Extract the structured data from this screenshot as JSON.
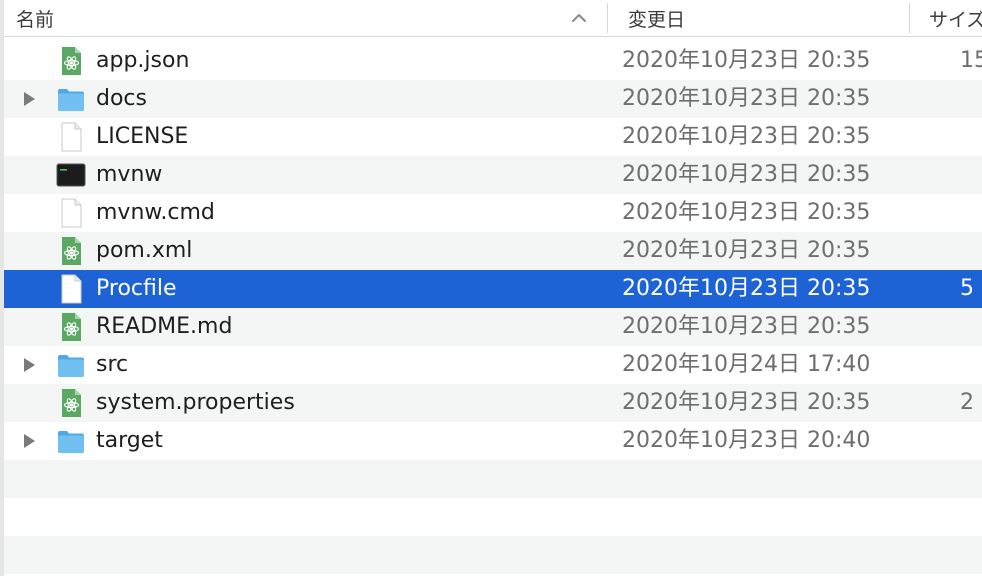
{
  "columns": {
    "name": "名前",
    "date": "変更日",
    "size": "サイズ"
  },
  "colors": {
    "selection": "#1e63d6",
    "alt_row": "#f4f5f5",
    "folder": "#6fbff0",
    "atom_green": "#5aa864"
  },
  "rows": [
    {
      "name": "app.json",
      "date": "2020年10月23日 20:35",
      "size": "15",
      "icon": "atom-file-icon"
    },
    {
      "name": "docs",
      "date": "2020年10月23日 20:35",
      "size": "",
      "icon": "folder-icon"
    },
    {
      "name": "LICENSE",
      "date": "2020年10月23日 20:35",
      "size": "",
      "icon": "blank-document-icon"
    },
    {
      "name": "mvnw",
      "date": "2020年10月23日 20:35",
      "size": "",
      "icon": "terminal-executable-icon"
    },
    {
      "name": "mvnw.cmd",
      "date": "2020年10月23日 20:35",
      "size": "",
      "icon": "blank-document-icon"
    },
    {
      "name": "pom.xml",
      "date": "2020年10月23日 20:35",
      "size": "",
      "icon": "atom-file-icon"
    },
    {
      "name": "Procfile",
      "date": "2020年10月23日 20:35",
      "size": "5",
      "icon": "blank-document-icon",
      "selected": true
    },
    {
      "name": "README.md",
      "date": "2020年10月23日 20:35",
      "size": "",
      "icon": "atom-file-icon"
    },
    {
      "name": "src",
      "date": "2020年10月24日 17:40",
      "size": "",
      "icon": "folder-icon"
    },
    {
      "name": "system.properties",
      "date": "2020年10月23日 20:35",
      "size": "2",
      "icon": "atom-file-icon"
    },
    {
      "name": "target",
      "date": "2020年10月23日 20:40",
      "size": "",
      "icon": "folder-icon"
    }
  ]
}
